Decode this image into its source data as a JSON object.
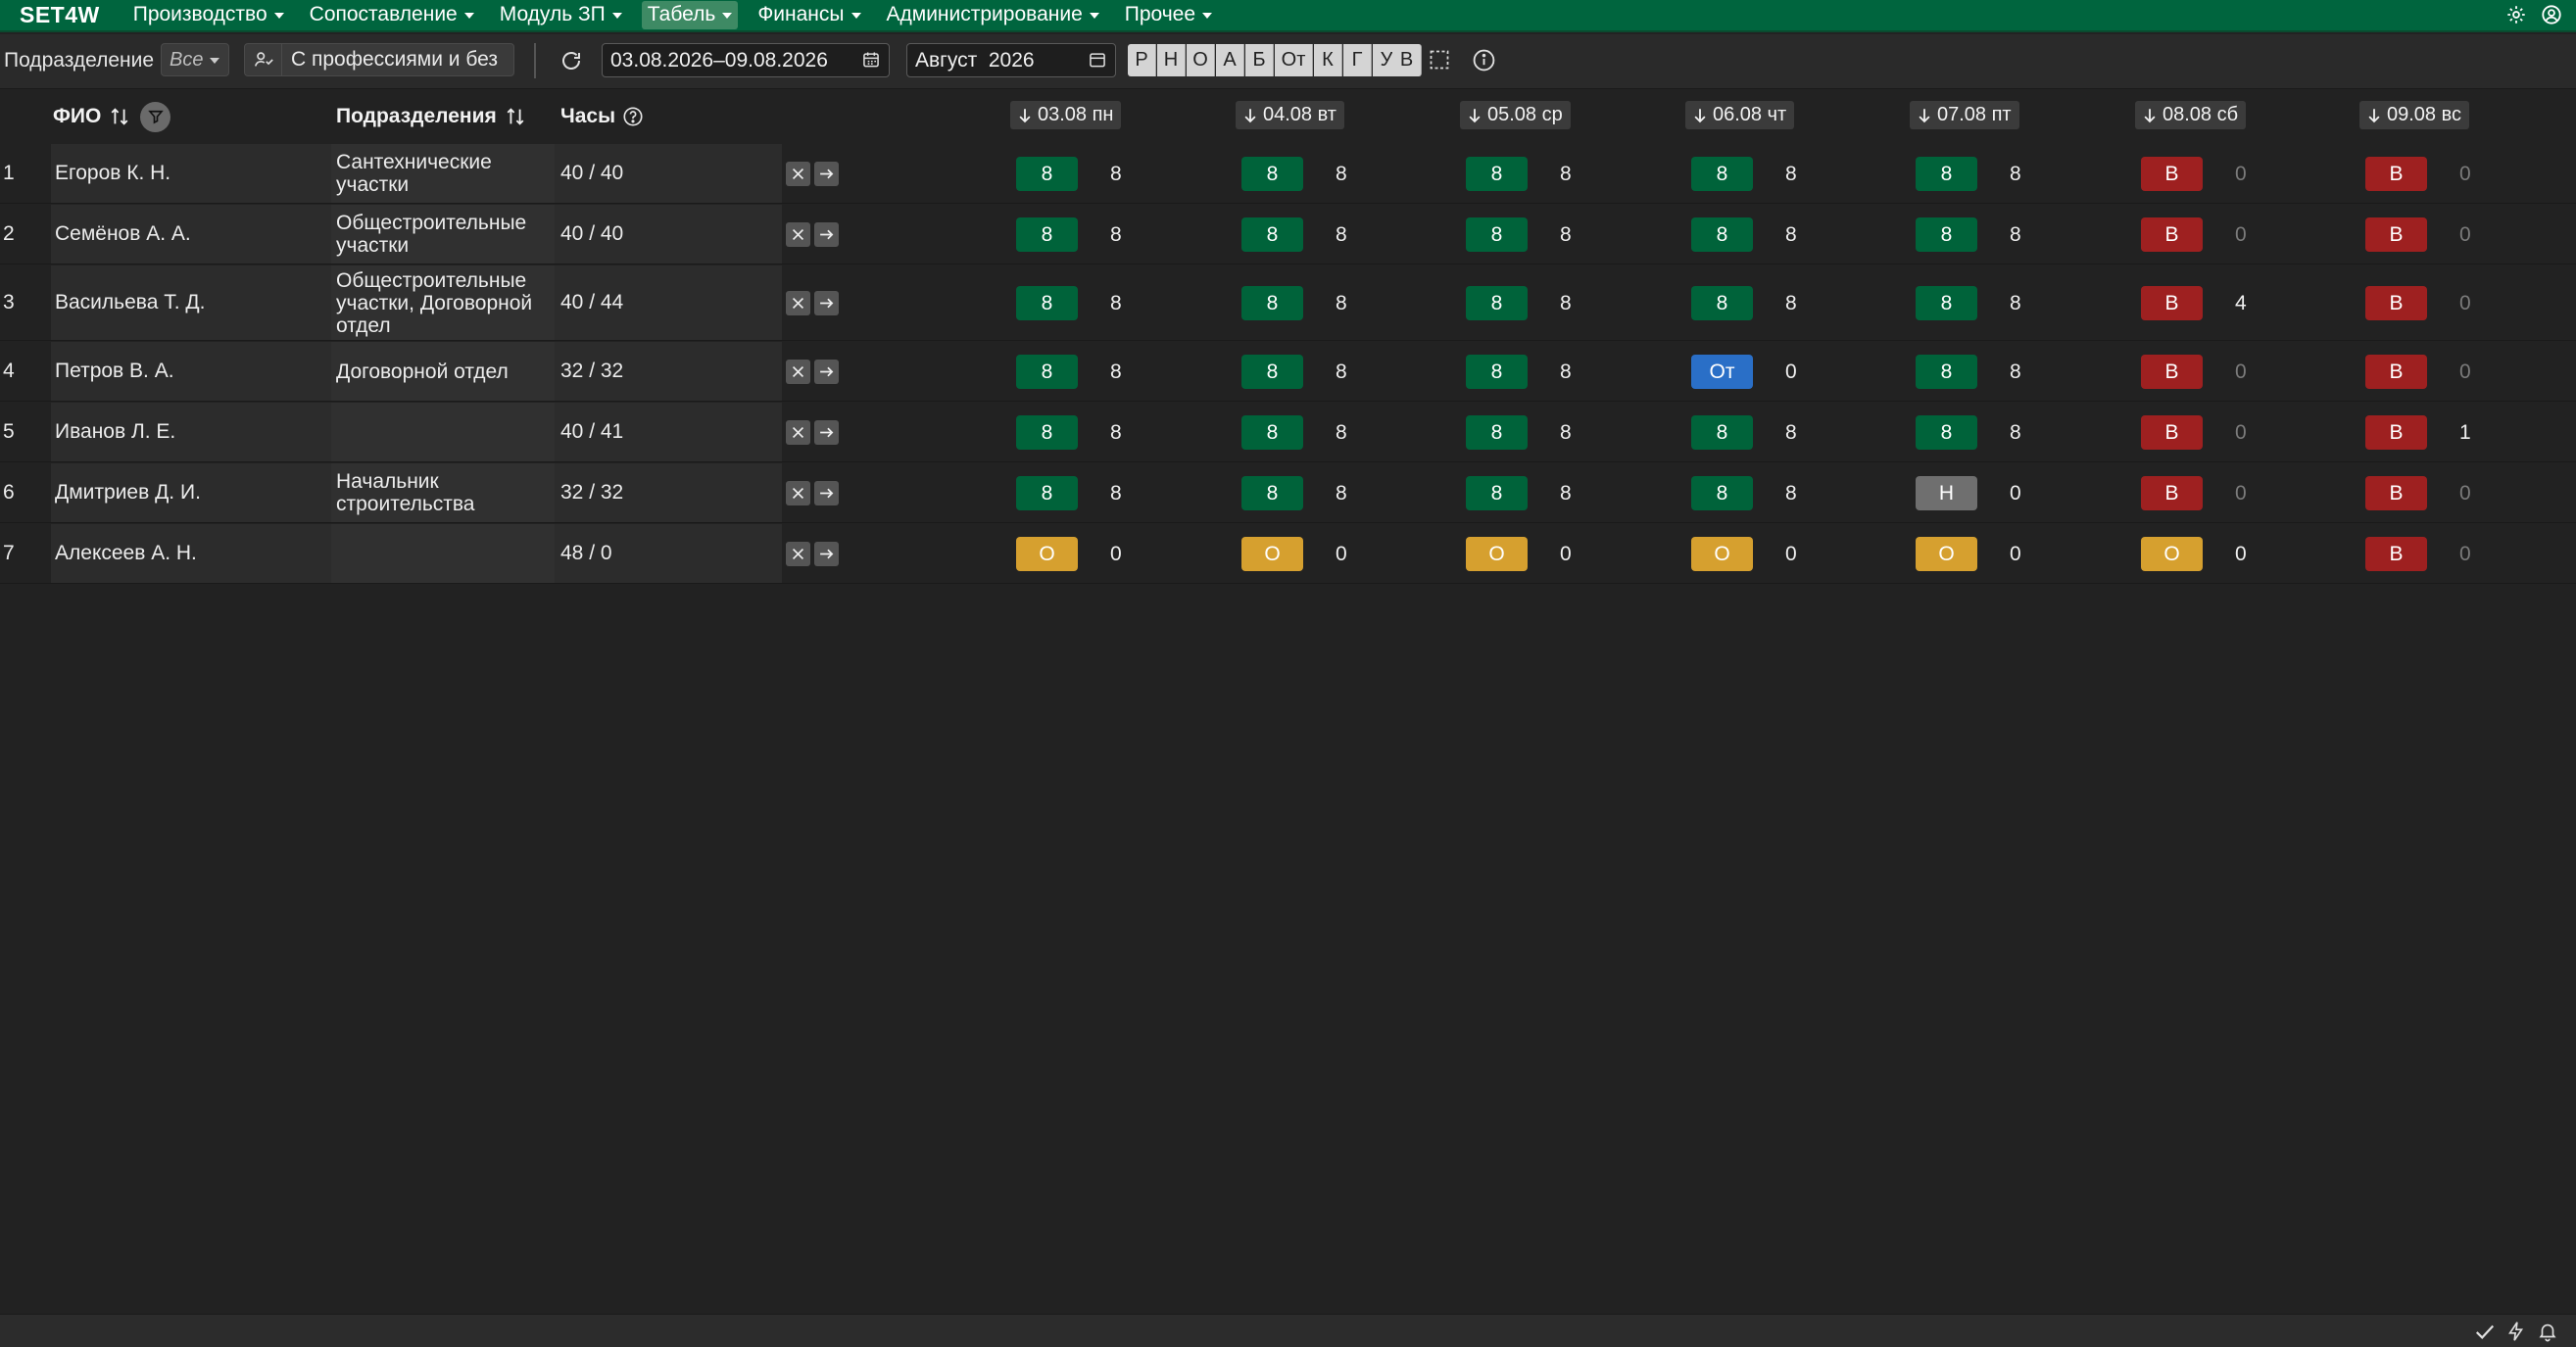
{
  "nav": {
    "brand": "SET4W",
    "items": [
      "Производство",
      "Сопоставление",
      "Модуль ЗП",
      "Табель",
      "Финансы",
      "Администрирование",
      "Прочее"
    ],
    "active": "Табель",
    "accent": "#00653e"
  },
  "toolbar": {
    "division_label": "Подразделение",
    "division_value": "Все",
    "professions_label": "С профессиями и без",
    "date_range": "03.08.2026–09.08.2026",
    "month_value": "Август  2026",
    "type_buttons": [
      "Р",
      "Н",
      "О",
      "А",
      "Б",
      "От",
      "К",
      "Г",
      "У",
      "В"
    ]
  },
  "table": {
    "col_name": "ФИО",
    "col_division": "Подразделения",
    "col_hours": "Часы",
    "days": [
      "03.08 пн",
      "04.08 вт",
      "05.08 ср",
      "06.08 чт",
      "07.08 пт",
      "08.08 сб",
      "09.08 вс"
    ],
    "rows": [
      {
        "num": "1",
        "name": "Егоров К. Н.",
        "division": "Сантехнические участки",
        "hours": "40 / 40",
        "days": [
          [
            "8",
            "8",
            "green"
          ],
          [
            "8",
            "8",
            "green"
          ],
          [
            "8",
            "8",
            "green"
          ],
          [
            "8",
            "8",
            "green"
          ],
          [
            "8",
            "8",
            "green"
          ],
          [
            "В",
            "0",
            "red"
          ],
          [
            "В",
            "0",
            "red"
          ]
        ]
      },
      {
        "num": "2",
        "name": "Семёнов А. А.",
        "division": "Общестроительные участки",
        "hours": "40 / 40",
        "days": [
          [
            "8",
            "8",
            "green"
          ],
          [
            "8",
            "8",
            "green"
          ],
          [
            "8",
            "8",
            "green"
          ],
          [
            "8",
            "8",
            "green"
          ],
          [
            "8",
            "8",
            "green"
          ],
          [
            "В",
            "0",
            "red"
          ],
          [
            "В",
            "0",
            "red"
          ]
        ]
      },
      {
        "num": "3",
        "name": "Васильева Т. Д.",
        "division": "Общестроительные участки, Договорной отдел",
        "hours": "40 / 44",
        "days": [
          [
            "8",
            "8",
            "green"
          ],
          [
            "8",
            "8",
            "green"
          ],
          [
            "8",
            "8",
            "green"
          ],
          [
            "8",
            "8",
            "green"
          ],
          [
            "8",
            "8",
            "green"
          ],
          [
            "В",
            "4",
            "red"
          ],
          [
            "В",
            "0",
            "red"
          ]
        ]
      },
      {
        "num": "4",
        "name": "Петров В. А.",
        "division": "Договорной отдел",
        "hours": "32 / 32",
        "days": [
          [
            "8",
            "8",
            "green"
          ],
          [
            "8",
            "8",
            "green"
          ],
          [
            "8",
            "8",
            "green"
          ],
          [
            "От",
            "0",
            "blue"
          ],
          [
            "8",
            "8",
            "green"
          ],
          [
            "В",
            "0",
            "red"
          ],
          [
            "В",
            "0",
            "red"
          ]
        ]
      },
      {
        "num": "5",
        "name": "Иванов Л. Е.",
        "division": "",
        "hours": "40 / 41",
        "days": [
          [
            "8",
            "8",
            "green"
          ],
          [
            "8",
            "8",
            "green"
          ],
          [
            "8",
            "8",
            "green"
          ],
          [
            "8",
            "8",
            "green"
          ],
          [
            "8",
            "8",
            "green"
          ],
          [
            "В",
            "0",
            "red"
          ],
          [
            "В",
            "1",
            "red"
          ]
        ]
      },
      {
        "num": "6",
        "name": "Дмитриев Д. И.",
        "division": "Начальник строительства",
        "hours": "32 / 32",
        "days": [
          [
            "8",
            "8",
            "green"
          ],
          [
            "8",
            "8",
            "green"
          ],
          [
            "8",
            "8",
            "green"
          ],
          [
            "8",
            "8",
            "green"
          ],
          [
            "Н",
            "0",
            "gray"
          ],
          [
            "В",
            "0",
            "red"
          ],
          [
            "В",
            "0",
            "red"
          ]
        ]
      },
      {
        "num": "7",
        "name": "Алексеев А. Н.",
        "division": "",
        "hours": "48 / 0",
        "days": [
          [
            "О",
            "0",
            "orange"
          ],
          [
            "О",
            "0",
            "orange"
          ],
          [
            "О",
            "0",
            "orange"
          ],
          [
            "О",
            "0",
            "orange"
          ],
          [
            "О",
            "0",
            "orange"
          ],
          [
            "О",
            "0",
            "orange"
          ],
          [
            "В",
            "0",
            "red"
          ]
        ]
      }
    ]
  },
  "colors": {
    "green": "#00633a",
    "red": "#9e2020",
    "orange": "#d6a02f",
    "blue": "#2a6fc7",
    "gray": "#6f6f6f"
  }
}
